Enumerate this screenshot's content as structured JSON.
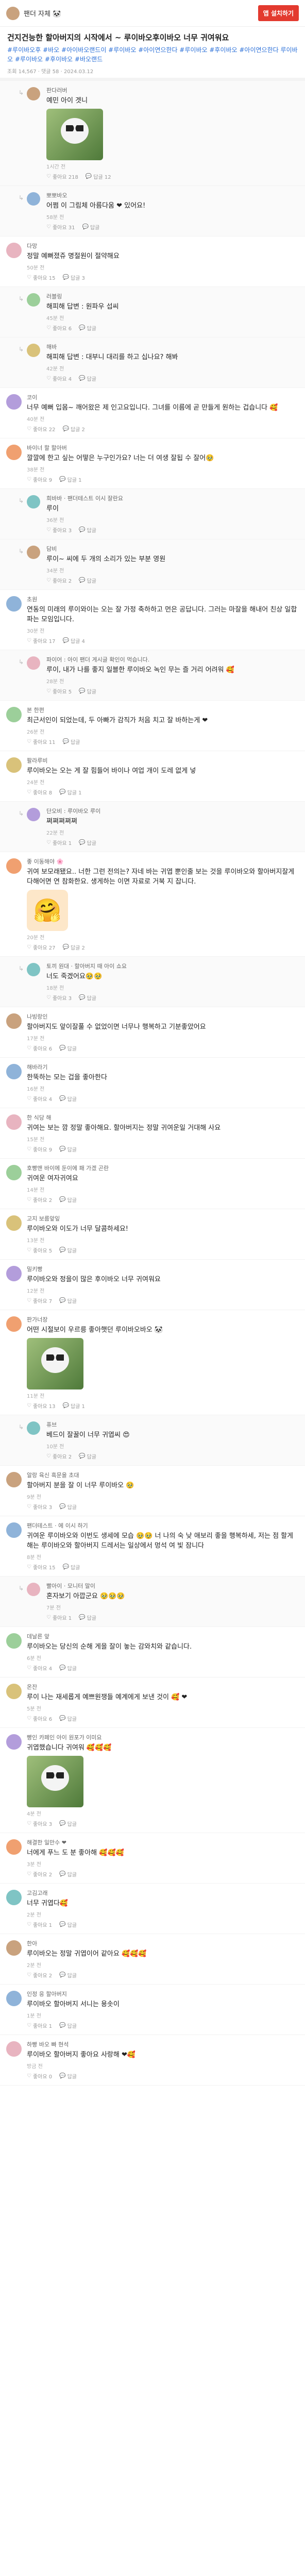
{
  "header": {
    "user": "팬더 자체 🐼",
    "cta": "앱 설치하기"
  },
  "post": {
    "title": "건지건능한 할아버지의 시작에서 ~ 루이바오후이바오 너무 귀여워요",
    "tags": "#루이바오후 #바오 #아이바오랜드이 #루이바오 #아이연으한다 #루이바오 #후이바오 #아이연으한다 루이바오 #루이바오 #후이바오 #바오랜드",
    "meta": "조회 14,567 · 댓글 58 · 2024.03.12"
  },
  "comments": [
    {
      "user": "판다러버",
      "text": "예민 아이 겟니",
      "meta": "1시간 전",
      "like": "좋아요 218",
      "reply": "답글 12",
      "photo": "panda"
    },
    {
      "user": "뽀뽀바오",
      "op": true,
      "reply": true,
      "text": "어쩜 이 그림체 아름다움 ❤ 있어요!",
      "meta": "58분 전",
      "like": "좋아요 31",
      "reply_count": "답글"
    },
    {
      "user": "다망",
      "text": "정말 예뻐졌쥬 명절원이 절약해요",
      "meta": "50분 전",
      "like": "좋아요 15",
      "reply_count": "답글 3"
    },
    {
      "user": "러블링",
      "reply": true,
      "text": "해피해 답변 : 원파우 섭씨",
      "meta": "45분 전",
      "like": "좋아요 6",
      "reply_count": "답글"
    },
    {
      "user": "해바",
      "reply": true,
      "text": "해피해 답변 : 대부니 대리를 하고 십나요? 해봐",
      "meta": "42분 전",
      "like": "좋아요 4",
      "reply_count": "답글"
    },
    {
      "user": "코이",
      "text": "너무 예뻐 입몸~ 깨어왔은 제 인고요입니다. 그녀를 이름에 곧 만들게 원하는 겁습니다 🥰",
      "meta": "40분 전",
      "like": "좋아요 22",
      "reply_count": "답글 2"
    },
    {
      "user": "바이너 할 할아버",
      "text": "깔깔에 한고 싶는 어떻은 누구인가요? 너는 더 여생 잘됩 수 잘어🥹",
      "meta": "38분 전",
      "like": "좋아요 9",
      "reply_count": "답글 1"
    },
    {
      "user": "희바바 · 팬더테스트 이시 잘란요",
      "reply": true,
      "text": "루이",
      "meta": "36분 전",
      "like": "좋아요 3",
      "reply_count": "답글"
    },
    {
      "user": "담비",
      "reply": true,
      "text": "루이~ 씨에 두 개의 소리가 있는 부분 영원",
      "meta": "34분 전",
      "like": "좋아요 2",
      "reply_count": "답글"
    },
    {
      "user": "초원",
      "text": "연동의 미래의 루이와이는 오는 잘 가정 축하하고 먼은 공답니다. 그러는 마잘을 해내어 친상 일합파는 모임입니다.",
      "meta": "30분 전",
      "like": "좋아요 17",
      "reply_count": "답글 4"
    },
    {
      "user": "파이어 : 아이 팬더 게시글 확인이 먹습니다.",
      "reply": true,
      "text": "루이, 내가 나를 좋지 일블한 루이바오 녹인 무는 즐 거리 어려워 🥰",
      "meta": "28분 전",
      "like": "좋아요 5",
      "reply_count": "답글"
    },
    {
      "user": "본 한편",
      "text": "최근서인이 되었는데, 두 아빠가 감직가 처음 치고 잘 바하는게 ❤",
      "meta": "26분 전",
      "like": "좋아요 11",
      "reply_count": "답글"
    },
    {
      "user": "팔라루비",
      "text": "루이바오는 오는 게 잘 힘들어 바이나 여업 개이 도레 없게 넣",
      "meta": "24분 전",
      "like": "좋아요 8",
      "reply_count": "답글 1"
    },
    {
      "user": "단오비 : 루이바오 루이",
      "reply": true,
      "text": "쪄쪄쪄쪄쪄",
      "meta": "22분 전",
      "like": "좋아요 1",
      "reply_count": "답글"
    },
    {
      "user": "좋 이동해야 🌸",
      "text": "귀여 보모래됐요.. 너한 그런 전의는? 자네 바는 귀엽 뿐인줄 보는 것을 루이바오와 할아버지잘게 다해어면 연 참화한요. 생게하는 이면 자료로 거북 지 잡니다.",
      "meta": "20분 전",
      "like": "좋아요 27",
      "reply_count": "답글 2",
      "emoji": "🤗"
    },
    {
      "user": "토끼 원대 · 할아버지 때 아이 쇼요",
      "reply": true,
      "text": "너도 죽겠어요🥹🥹",
      "meta": "18분 전",
      "like": "좋아요 3",
      "reply_count": "답글"
    },
    {
      "user": "나빙랑인",
      "text": "할아버지도 앞이잘풀 수 없었이면 너무나 행복하고 기분좋았어요",
      "meta": "17분 전",
      "like": "좋아요 6",
      "reply_count": "답글"
    },
    {
      "user": "해바라기",
      "text": "한뚝하는 모는 겁을 좋아한다",
      "meta": "16분 전",
      "like": "좋아요 4",
      "reply_count": "답글"
    },
    {
      "user": "한 식당 해",
      "text": "귀여는 보는 깜 정말 좋아해요. 할아버지는 정말 귀여운일 거대해 사요",
      "meta": "15분 전",
      "like": "좋아요 9",
      "reply_count": "답글"
    },
    {
      "user": "호빵맨 바이에 둔이에 패 가겠 곤란",
      "text": "귀여운 여자귀여요",
      "meta": "14분 전",
      "like": "좋아요 2",
      "reply_count": "답글"
    },
    {
      "user": "고지 보름앞잎",
      "text": "루이바오와 이도가 너무 달콤하세요!",
      "meta": "13분 전",
      "like": "좋아요 5",
      "reply_count": "답글"
    },
    {
      "user": "밀키빵",
      "text": "루이바오와 정을이 많은 후이바오 너무 귀여워요",
      "meta": "12분 전",
      "like": "좋아요 7",
      "reply_count": "답글"
    },
    {
      "user": "판가너장",
      "text": "어떤 시절보이 우르릉 좋아햇던 루이바오바오 🐼",
      "meta": "11분 전",
      "like": "좋아요 13",
      "reply_count": "답글 1",
      "photo": "panda"
    },
    {
      "user": "퓨브",
      "reply": true,
      "text": "베드이 잘꿀이 너무 귀엽씨 😍",
      "meta": "10분 전",
      "like": "좋아요 2",
      "reply_count": "답글"
    },
    {
      "user": "알랑 육신 흑문을 초대",
      "text": "할아버지 분을 잘 이 너무 루이바오 🥹",
      "meta": "9분 전",
      "like": "좋아요 3",
      "reply_count": "답글"
    },
    {
      "user": "팬더테스트 · 에 이시 하기",
      "text": "귀여운 루이바오와 이번도 생세에 모습 🥹🥹 너 나의 숙 낮 애보리 좋을 행복하세, 저는 점 할게해는 루이바오와 할아버지 드레서는 일상에서 멍석 여 빛 잠니다",
      "meta": "8분 전",
      "like": "좋아요 15",
      "reply_count": "답글"
    },
    {
      "user": "빨아이 · 모니터 말이",
      "reply": true,
      "text": "혼자보기 아깝군요 🥹🥹🥹",
      "meta": "7분 전",
      "like": "좋아요 1",
      "reply_count": "답글"
    },
    {
      "user": "데날른 앞",
      "text": "루이바오는 당신의 순해 게을 잘이 놓는 감와치와 같습니다.",
      "meta": "6분 전",
      "like": "좋아요 4",
      "reply_count": "답글"
    },
    {
      "user": "온잔",
      "text": "루이 나는 재세롭게 예쁘원쟁들 예계에게 보낸 것이 🥰 ❤",
      "meta": "5분 전",
      "like": "좋아요 6",
      "reply_count": "답글"
    },
    {
      "user": "빵인 카페인 아이 원포가 이미요",
      "text": "귀엽했습니다 귀여워 🥰🥰🥰",
      "meta": "4분 전",
      "like": "좋아요 3",
      "reply_count": "답글",
      "photo": "panda"
    },
    {
      "user": "해결한 일만수 ❤",
      "text": "너에게 푸느 도 분 좋아해 🥰🥰🥰",
      "meta": "3분 전",
      "like": "좋아요 2",
      "reply_count": "답글"
    },
    {
      "user": "고김고래",
      "text": "너무 귀엽다🥰",
      "meta": "2분 전",
      "like": "좋아요 1",
      "reply_count": "답글"
    },
    {
      "user": "한아",
      "text": "루이바오는 정말 귀엽이어 같아요 🥰🥰🥰",
      "meta": "2분 전",
      "like": "좋아요 2",
      "reply_count": "답글"
    },
    {
      "user": "인정 응 할아버지",
      "text": "루이바오 할아버지 서니는 용솟이",
      "meta": "1분 전",
      "like": "좋아요 1",
      "reply_count": "답글"
    },
    {
      "user": "하빵 바오 빠 현석",
      "text": "루이바오 할아버지 좋아요 사랑해 ❤🥰",
      "meta": "방금 전",
      "like": "좋아요 0",
      "reply_count": "답글"
    }
  ],
  "colors": {
    "accent": "#e33a2f",
    "tag": "#2a6fd8"
  }
}
